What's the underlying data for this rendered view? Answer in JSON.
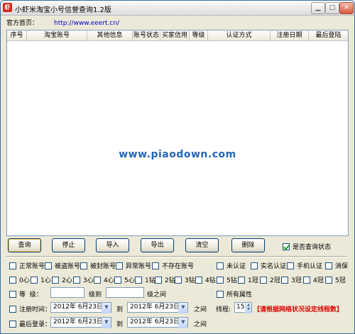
{
  "window": {
    "title": "小虾米淘宝小号信誉查询1.2版",
    "icon_text": "虾",
    "controls": [
      "minimize-icon",
      "maximize-icon",
      "close-icon"
    ]
  },
  "home": {
    "label": "官方首页：",
    "url": "http://www.eeert.cn/"
  },
  "grid": {
    "columns": [
      "序号",
      "淘宝账号",
      "其他信息",
      "账号状态",
      "买家信用",
      "等级",
      "认证方式",
      "注册日期",
      "最后登陆"
    ],
    "rows": []
  },
  "watermark": "www.piaodown.com",
  "actions": {
    "query": "查询",
    "stop": "停止",
    "import": "导入",
    "export": "导出",
    "clear": "清空",
    "delete": "删除",
    "query_status": "是否查询状态"
  },
  "filters": {
    "row1": [
      "正常账号",
      "被盗账号",
      "被封账号",
      "异常账号",
      "不存在账号",
      "未认证",
      "实名认证",
      "手机认证",
      "消保"
    ],
    "row2": [
      "0心",
      "1心",
      "2心",
      "3心",
      "4心",
      "5心",
      "1钻",
      "2钻",
      "3钻",
      "4钻",
      "5钻",
      "1冠",
      "2冠",
      "3冠",
      "4冠",
      "5冠"
    ],
    "level_label": "等  级：",
    "level_mid": "级到",
    "level_end": "级之间",
    "all_attr": "所有属性",
    "reg_time": "注册时间：",
    "last_login": "最后登录：",
    "to": "到",
    "between": "之间",
    "date_from": "2012年 6月23日",
    "date_to": "2012年 6月23日",
    "login_from": "2012年 6月23日",
    "login_to": "2012年 6月23日",
    "threads_label": "线程:",
    "threads": "15",
    "hint": "【请根据网络状况设定线程数】"
  },
  "colors": {
    "accent": "#2366b8",
    "link": "#0000c8",
    "hint": "#e00000"
  }
}
